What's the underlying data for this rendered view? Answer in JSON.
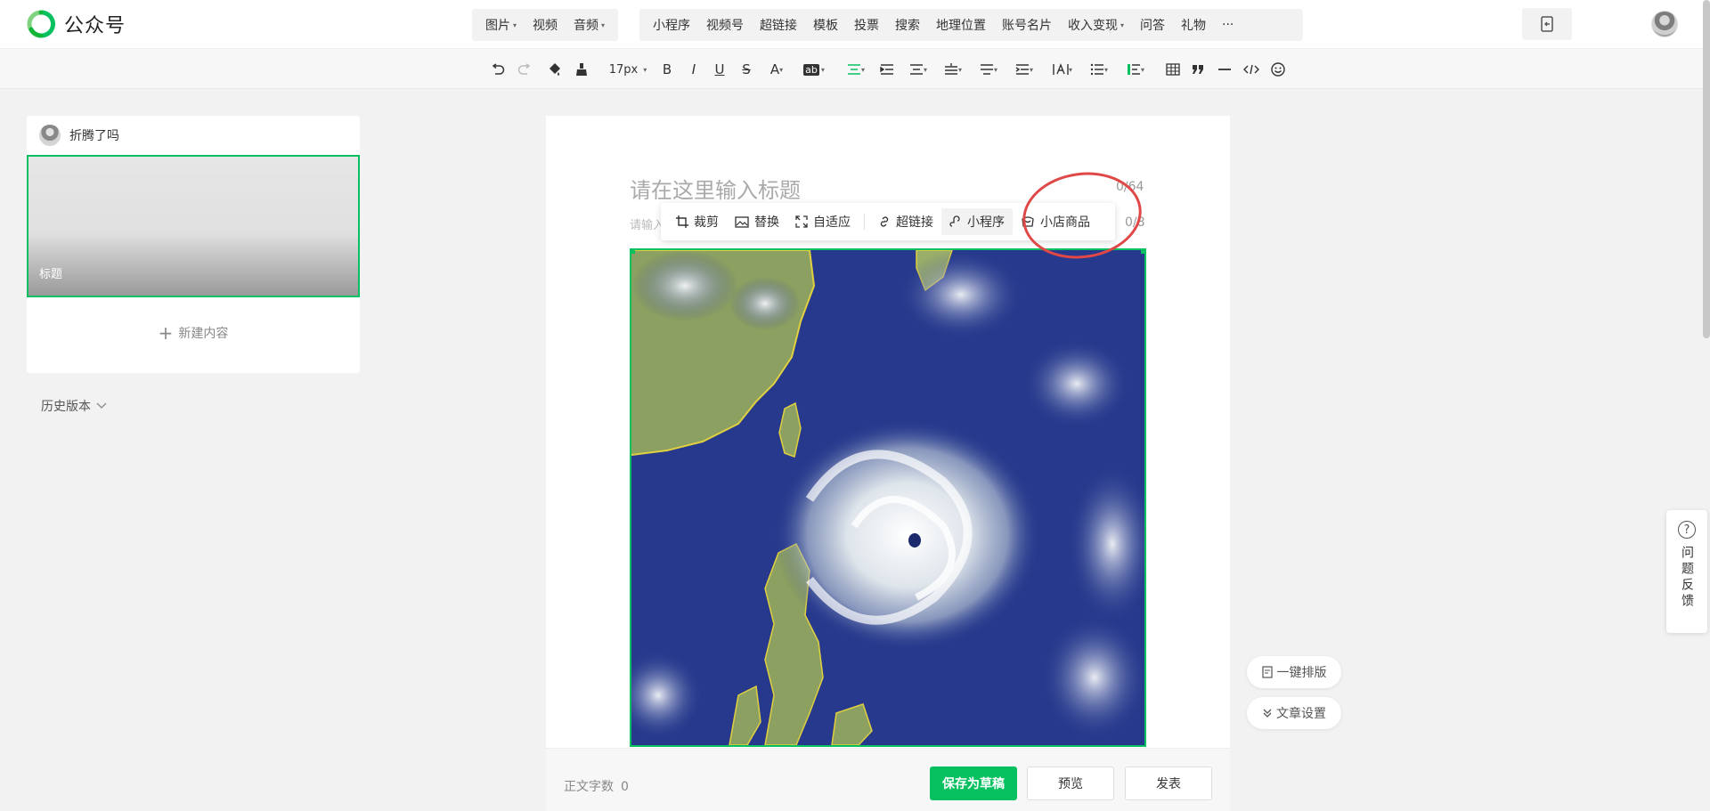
{
  "brand": {
    "name": "公众号",
    "accent": "#07c160"
  },
  "insert_menu": {
    "group1": [
      {
        "label": "图片",
        "dropdown": true
      },
      {
        "label": "视频",
        "dropdown": false
      },
      {
        "label": "音频",
        "dropdown": true
      }
    ],
    "group2": [
      {
        "label": "小程序",
        "dropdown": false
      },
      {
        "label": "视频号",
        "dropdown": false
      },
      {
        "label": "超链接",
        "dropdown": false
      },
      {
        "label": "模板",
        "dropdown": false
      },
      {
        "label": "投票",
        "dropdown": false
      },
      {
        "label": "搜索",
        "dropdown": false
      },
      {
        "label": "地理位置",
        "dropdown": false
      },
      {
        "label": "账号名片",
        "dropdown": false
      },
      {
        "label": "收入变现",
        "dropdown": true
      },
      {
        "label": "问答",
        "dropdown": false
      },
      {
        "label": "礼物",
        "dropdown": false
      },
      {
        "label": "···",
        "dropdown": false
      }
    ]
  },
  "format_toolbar": {
    "font_size": "17px",
    "bold": "B",
    "italic": "I",
    "underline": "U",
    "strike": "S",
    "font_color": "A",
    "bg_color": "ab"
  },
  "sidebar": {
    "account_name": "折腾了吗",
    "article_thumb_title": "标题",
    "new_content": "新建内容",
    "history": "历史版本"
  },
  "editor": {
    "title_placeholder": "请在这里输入标题",
    "title_count": "0/64",
    "author_placeholder": "请输入",
    "author_count": "0/8"
  },
  "image_toolbar": {
    "crop": "裁剪",
    "replace": "替换",
    "fit": "自适应",
    "link": "超链接",
    "miniapp": "小程序",
    "shop": "小店商品"
  },
  "bottom": {
    "word_count_label": "正文字数",
    "word_count": "0",
    "save_draft": "保存为草稿",
    "preview": "预览",
    "publish": "发表"
  },
  "floating": {
    "one_click_layout": "一键排版",
    "article_settings": "文章设置",
    "feedback": "问题反馈",
    "feedback_icon": "?"
  }
}
